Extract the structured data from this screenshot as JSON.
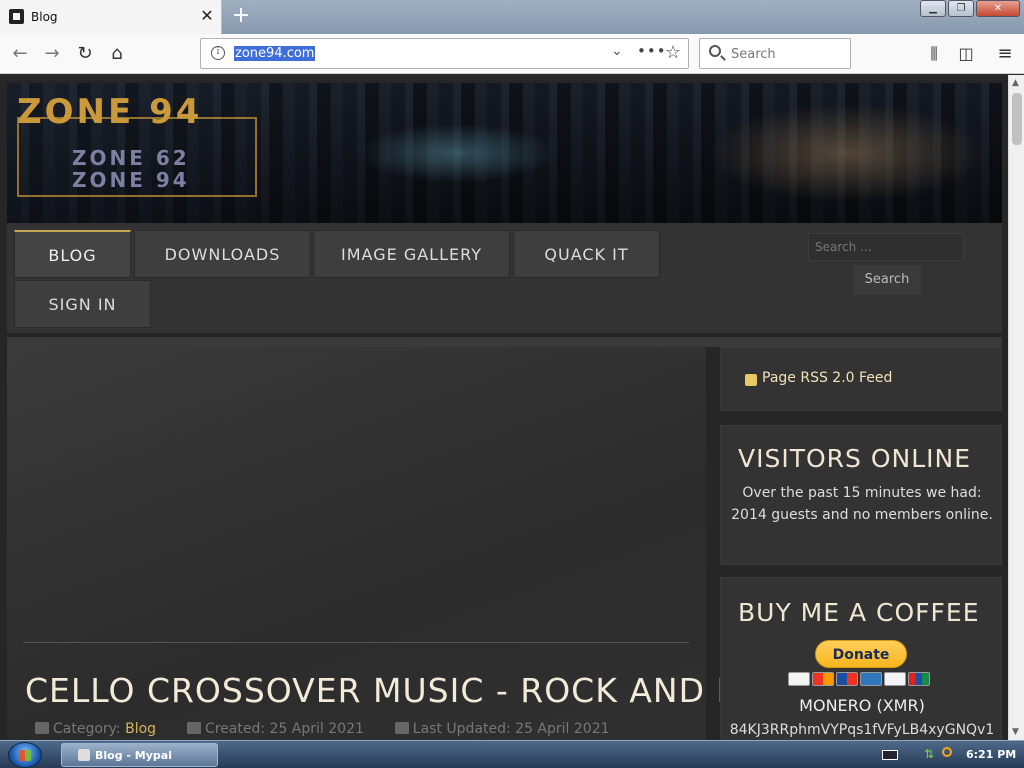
{
  "browser": {
    "tab_title": "Blog",
    "url": "zone94.com",
    "search_placeholder": "Search",
    "new_tab_symbol": "+",
    "close_symbol": "✕"
  },
  "site": {
    "logo_line1": "ZONE 94",
    "logo_line2": "ZONE 62",
    "logo_line3": "ZONE 94",
    "menu": [
      {
        "label": "BLOG",
        "active": true
      },
      {
        "label": "DOWNLOADS"
      },
      {
        "label": "IMAGE GALLERY"
      },
      {
        "label": "QUACK IT"
      },
      {
        "label": "SIGN IN"
      }
    ],
    "search_placeholder": "Search ...",
    "search_button": "Search"
  },
  "article": {
    "title": "CELLO CROSSOVER MUSIC - ROCK AND METAL",
    "category_label": "Category:",
    "category_value": "Blog",
    "created": "Created: 25 April 2021",
    "updated": "Last Updated: 25 April 2021"
  },
  "sidebar": {
    "rss_label": "Page RSS 2.0 Feed",
    "visitors_title": "VISITORS ONLINE",
    "visitors_text": "Over the past 15 minutes we had: 2014 guests and no members online.",
    "coffee_title": "BUY ME A COFFEE",
    "donate_label": "Donate",
    "monero_label": "MONERO (XMR)",
    "monero_address": "84KJ3RRphmVYPqs1fVFyLB4xyGNQv1"
  },
  "taskbar": {
    "task_label": "Blog - Mypal",
    "clock": "6:21 PM"
  },
  "colors": {
    "accent_gold": "#d7b35a",
    "page_bg": "#262626",
    "donate_yellow": "#f7b51e"
  }
}
